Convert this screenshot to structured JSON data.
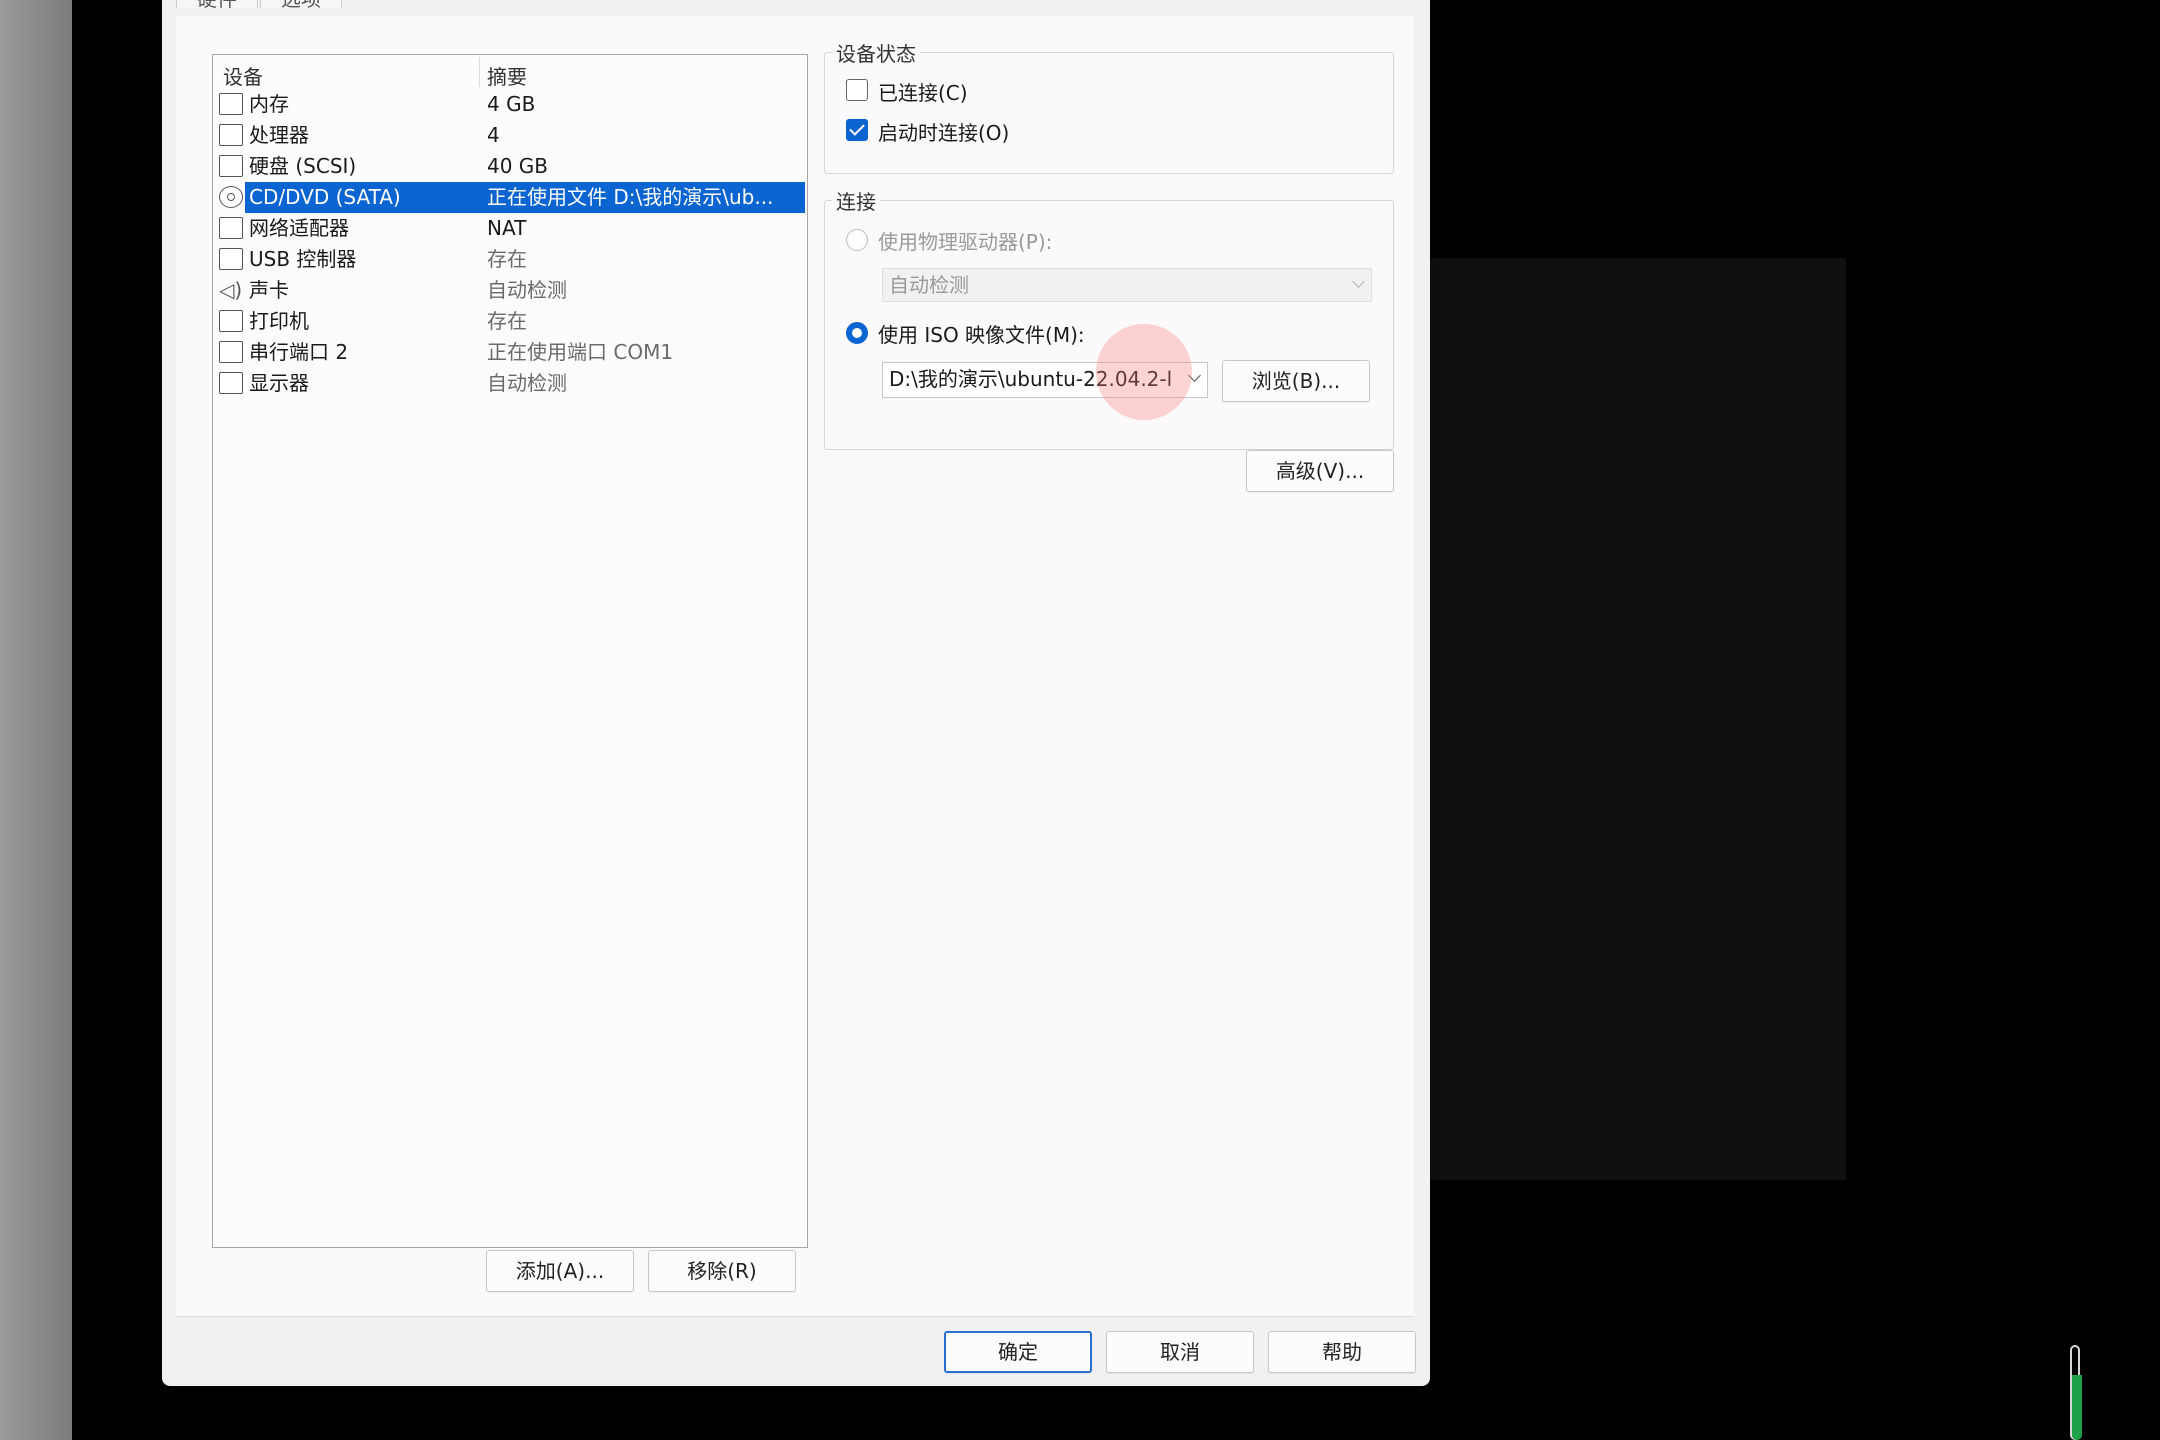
{
  "dialog": {
    "tabs": [
      {
        "label": "硬件"
      },
      {
        "label": "选项"
      }
    ]
  },
  "device_list": {
    "headers": {
      "device": "设备",
      "summary": "摘要"
    },
    "rows": [
      {
        "icon": "memory-icon",
        "name": "内存",
        "summary": "4 GB"
      },
      {
        "icon": "processor-icon",
        "name": "处理器",
        "summary": "4"
      },
      {
        "icon": "hard-disk-icon",
        "name": "硬盘 (SCSI)",
        "summary": "40 GB"
      },
      {
        "icon": "cd-dvd-icon",
        "name": "CD/DVD (SATA)",
        "summary": "正在使用文件 D:\\我的演示\\ub..."
      },
      {
        "icon": "network-adapter-icon",
        "name": "网络适配器",
        "summary": "NAT"
      },
      {
        "icon": "usb-controller-icon",
        "name": "USB 控制器",
        "summary": "存在"
      },
      {
        "icon": "sound-card-icon",
        "name": "声卡",
        "summary": "自动检测"
      },
      {
        "icon": "printer-icon",
        "name": "打印机",
        "summary": "存在"
      },
      {
        "icon": "serial-port-icon",
        "name": "串行端口 2",
        "summary": "正在使用端口 COM1"
      },
      {
        "icon": "display-icon",
        "name": "显示器",
        "summary": "自动检测"
      }
    ],
    "selected_index": 3,
    "add_button": "添加(A)...",
    "remove_button": "移除(R)"
  },
  "device_status": {
    "title": "设备状态",
    "connected": {
      "label": "已连接(C)",
      "checked": false
    },
    "connect_at_power_on": {
      "label": "启动时连接(O)",
      "checked": true
    }
  },
  "connection": {
    "title": "连接",
    "physical_drive": {
      "label": "使用物理驱动器(P):",
      "selected": false,
      "enabled": false,
      "value": "自动检测"
    },
    "iso_image": {
      "label": "使用 ISO 映像文件(M):",
      "selected": true,
      "value": "D:\\我的演示\\ubuntu-22.04.2-l"
    },
    "browse_button": "浏览(B)..."
  },
  "advanced_button": "高级(V)...",
  "footer": {
    "ok": "确定",
    "cancel": "取消",
    "help": "帮助"
  },
  "colors": {
    "selection": "#0a64d2",
    "accent": "#2a6fd4",
    "indicator": "#1fa14a"
  }
}
